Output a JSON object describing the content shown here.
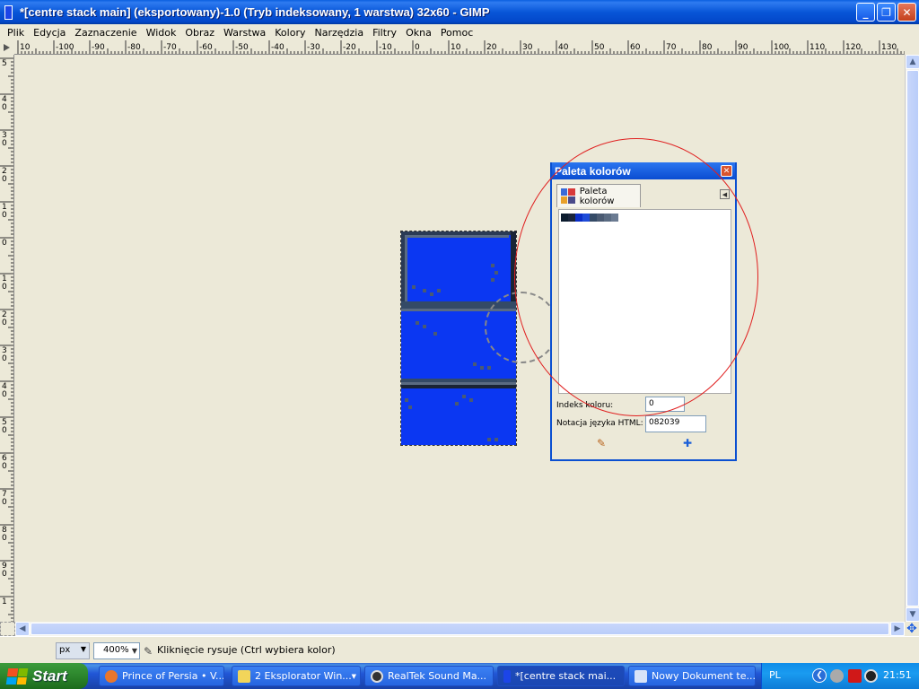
{
  "window": {
    "title": "*[centre stack main] (eksportowany)-1.0 (Tryb indeksowany, 1 warstwa) 32x60 - GIMP",
    "minimize": "_",
    "maximize": "❐",
    "close": "✕"
  },
  "menu": [
    "Plik",
    "Edycja",
    "Zaznaczenie",
    "Widok",
    "Obraz",
    "Warstwa",
    "Kolory",
    "Narzędzia",
    "Filtry",
    "Okna",
    "Pomoc"
  ],
  "ruler": {
    "horizontal_labels": [
      "10",
      "-100",
      "-90",
      "-80",
      "-70",
      "-60",
      "-50",
      "-40",
      "-30",
      "-20",
      "-10",
      "0",
      "10",
      "20",
      "30",
      "40",
      "50",
      "60",
      "70",
      "80",
      "90",
      "100",
      "110",
      "120",
      "130"
    ],
    "vertical_labels": [
      "5",
      "4 0",
      "3 0",
      "2 0",
      "1 0",
      "0",
      "1 0",
      "2 0",
      "3 0",
      "4 0",
      "5 0",
      "6 0",
      "7 0",
      "8 0",
      "9 0",
      "1"
    ]
  },
  "palette_dialog": {
    "title": "Paleta kolorów",
    "tab_label": "Paleta kolorów",
    "swatch_colors": [
      "#0b1b2e",
      "#18233a",
      "#0a2ec8",
      "#1e4bd8",
      "#344a66",
      "#4a5a72",
      "#5a6b82",
      "#6b7b92"
    ],
    "index_label": "Indeks koloru:",
    "index_value": "0",
    "html_label": "Notacja języka HTML:",
    "html_value": "082039",
    "edit_icon": "✎",
    "add_icon": "✚"
  },
  "statusbar": {
    "unit": "px",
    "zoom": "400%",
    "message": "Kliknięcie rysuje (Ctrl wybiera kolor)"
  },
  "taskbar": {
    "start_label": "Start",
    "tasks": [
      {
        "label": "Prince of Persia • V...",
        "icon_color": "#e8762c"
      },
      {
        "label": "2 Eksplorator Win...",
        "icon_color": "#f2d55a"
      },
      {
        "label": "RealTek Sound Ma...",
        "icon_color": "#333333"
      },
      {
        "label": "*[centre stack mai...",
        "icon_color": "#1c45e8"
      },
      {
        "label": "Nowy Dokument te...",
        "icon_color": "#d8e4f8"
      }
    ],
    "tray": {
      "language": "PL",
      "clock": "21:51"
    }
  },
  "colors": {
    "image_blue": "#0b37f2",
    "annotation_red": "#e02020"
  }
}
